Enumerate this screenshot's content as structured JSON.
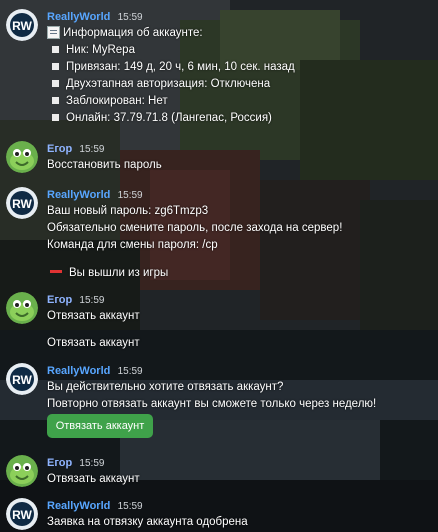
{
  "messages": {
    "m1": {
      "author": "ReallyWorld",
      "time": "15:59",
      "title": "Информация об аккаунте:",
      "items": [
        "Ник: MyRepa",
        "Привязан: 149 д, 20 ч, 6 мин, 10 сек. назад",
        "Двухэтапная авторизация: Отключена",
        "Заблокирован: Нет",
        "Онлайн: 37.79.71.8 (Лангепас, Россия)"
      ]
    },
    "m2": {
      "author": "Егор",
      "time": "15:59",
      "text": "Восстановить пароль"
    },
    "m3": {
      "author": "ReallyWorld",
      "time": "15:59",
      "lines": [
        "Ваш новый пароль: zg6Tmzp3",
        "Обязательно смените пароль, после захода на сервер!",
        "Команда для смены пароля: /cp"
      ],
      "status": "Вы вышли из игры"
    },
    "m4": {
      "author": "Егор",
      "time": "15:59",
      "lines": [
        "Отвязать аккаунт",
        "Отвязать аккаунт"
      ]
    },
    "m5": {
      "author": "ReallyWorld",
      "time": "15:59",
      "lines": [
        "Вы действительно хотите отвязать аккаунт?",
        "Повторно отвязать аккаунт вы сможете только через неделю!"
      ],
      "button": "Отвязать аккаунт"
    },
    "m6": {
      "author": "Егор",
      "time": "15:59",
      "text": "Отвязать аккаунт"
    },
    "m7": {
      "author": "ReallyWorld",
      "time": "15:59",
      "text": "Заявка на отвязку аккаунта одобрена"
    }
  },
  "avatars": {
    "bot_letters": "RW"
  },
  "colors": {
    "bot_name": "#58a6ff",
    "user_name": "#8fb4ff",
    "button": "#3fa24a",
    "exit_marker": "#e03333"
  }
}
